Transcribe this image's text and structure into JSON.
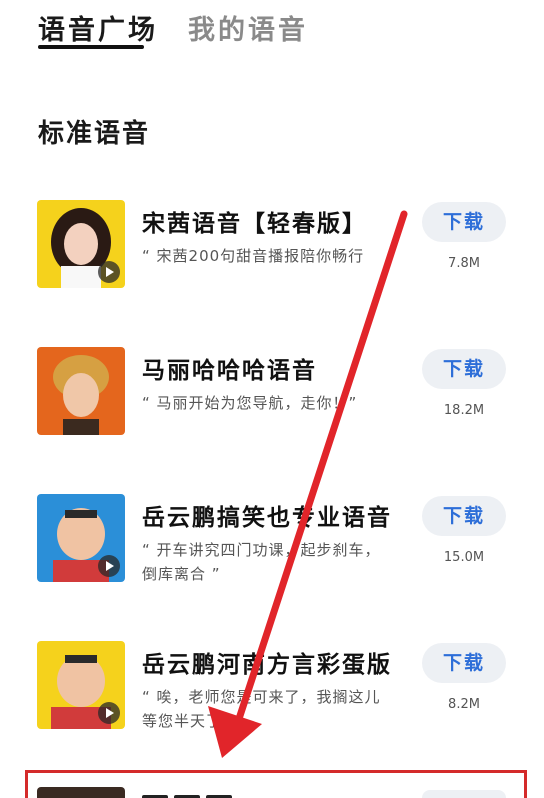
{
  "tabs": {
    "active": "语音广场",
    "inactive": "我的语音"
  },
  "section": {
    "title": "标准语音"
  },
  "items": [
    {
      "title": "宋茜语音【轻春版】",
      "desc": "“ 宋茜200句甜音播报陪你畅行",
      "button": "下载",
      "size": "7.8M"
    },
    {
      "title": "马丽哈哈哈语音",
      "desc": "“ 马丽开始为您导航，走你！”",
      "button": "下载",
      "size": "18.2M"
    },
    {
      "title": "岳云鹏搞笑也专业语音",
      "desc": "“ 开车讲究四门功课，起步刹车，倒库离合 ”",
      "button": "下载",
      "size": "15.0M"
    },
    {
      "title": "岳云鹏河南方言彩蛋版",
      "desc": "“ 唉，老师您是可来了，我搁这儿等您半天了 ”",
      "button": "下载",
      "size": "8.2M"
    }
  ],
  "colors": {
    "accent": "#2d6ed8",
    "annotation": "#d42a2a",
    "button_bg": "#edf0f4"
  },
  "icons": {
    "play": "play-icon",
    "arrow": "arrow-annotation"
  }
}
